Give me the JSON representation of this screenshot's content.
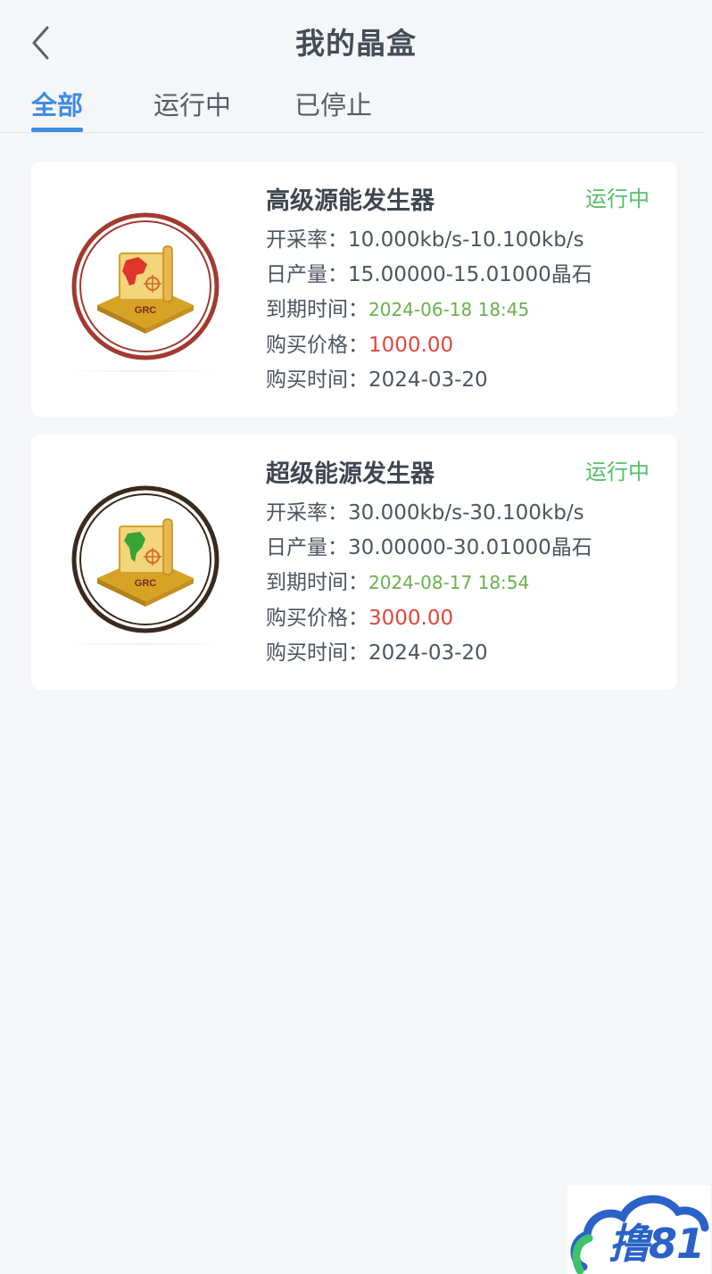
{
  "header": {
    "title": "我的晶盒"
  },
  "tabs": [
    {
      "label": "全部",
      "active": true
    },
    {
      "label": "运行中",
      "active": false
    },
    {
      "label": "已停止",
      "active": false
    }
  ],
  "cards": [
    {
      "name": "高级源能发生器",
      "status": "运行中",
      "rate_label": "开采率：",
      "rate_value": "10.000kb/s-10.100kb/s",
      "output_label": "日产量：",
      "output_value": "15.00000-15.01000晶石",
      "expire_label": "到期时间：",
      "expire_value": "2024-06-18 18:45",
      "price_label": "购买价格：",
      "price_value": "1000.00",
      "buy_label": "购买时间：",
      "buy_value": "2024-03-20",
      "logo_text": "GRC",
      "ring_color": "#a23a30",
      "map_color": "#e0352a"
    },
    {
      "name": "超级能源发生器",
      "status": "运行中",
      "rate_label": "开采率：",
      "rate_value": "30.000kb/s-30.100kb/s",
      "output_label": "日产量：",
      "output_value": "30.00000-30.01000晶石",
      "expire_label": "到期时间：",
      "expire_value": "2024-08-17 18:54",
      "price_label": "购买价格：",
      "price_value": "3000.00",
      "buy_label": "购买时间：",
      "buy_value": "2024-03-20",
      "logo_text": "GRC",
      "ring_color": "#3a2a1c",
      "map_color": "#3aa336"
    }
  ],
  "watermark": {
    "text": "撸81"
  }
}
